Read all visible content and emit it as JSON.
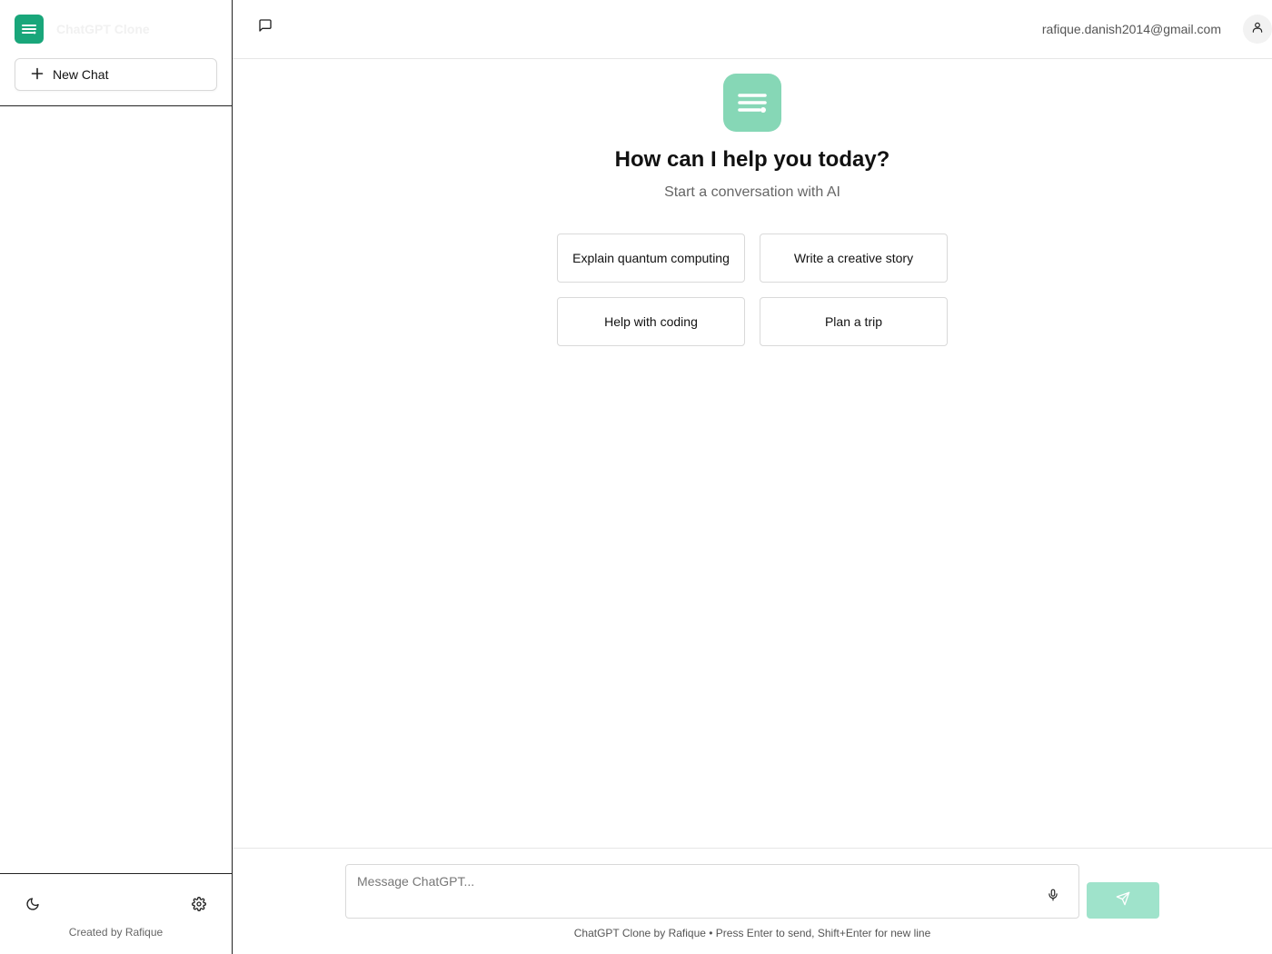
{
  "sidebar": {
    "brand_name": "ChatGPT Clone",
    "new_chat_label": "New Chat",
    "credit": "Created by Rafique"
  },
  "header": {
    "user_email": "rafique.danish2014@gmail.com"
  },
  "main": {
    "title": "How can I help you today?",
    "subtitle": "Start a conversation with AI",
    "suggestions": [
      "Explain quantum computing",
      "Write a creative story",
      "Help with coding",
      "Plan a trip"
    ]
  },
  "composer": {
    "placeholder": "Message ChatGPT...",
    "footer_note": "ChatGPT Clone by Rafique • Press Enter to send, Shift+Enter for new line"
  },
  "icons": {
    "brand": "menu-lines-icon",
    "new_chat": "plus-icon",
    "theme": "moon-icon",
    "settings": "gear-icon",
    "toggle": "message-square-icon",
    "user": "user-icon",
    "mic": "microphone-icon",
    "send": "send-icon"
  },
  "colors": {
    "accent": "#19a67a",
    "accent_light": "#86d7b6",
    "send_disabled": "#9fe3cb"
  }
}
